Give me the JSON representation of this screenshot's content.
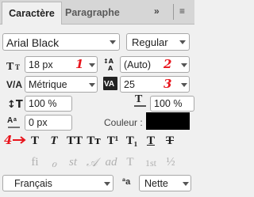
{
  "tabs": [
    {
      "label": "Caractère"
    },
    {
      "label": "Paragraphe"
    }
  ],
  "tabbar": {
    "more": "»",
    "menu": "≡"
  },
  "font": {
    "family": "Arial Black",
    "style": "Regular"
  },
  "size": {
    "value": "18 px",
    "annotation": "1"
  },
  "leading": {
    "value": "(Auto)",
    "annotation": "2"
  },
  "kerning": {
    "value": "Métrique"
  },
  "tracking": {
    "value": "25",
    "annotation": "3"
  },
  "vscale": {
    "value": "100 %"
  },
  "hscale": {
    "value": "100 %"
  },
  "baseline": {
    "value": "0 px"
  },
  "color": {
    "label": "Couleur :",
    "swatch": "#000000"
  },
  "styles": {
    "annotation": "4",
    "buttons": [
      {
        "name": "faux-bold-button",
        "glyph": "T"
      },
      {
        "name": "faux-italic-button",
        "glyph": "T"
      },
      {
        "name": "all-caps-button",
        "glyph": "TT"
      },
      {
        "name": "small-caps-button",
        "glyph": "Tт"
      },
      {
        "name": "superscript-button",
        "glyph": "T¹"
      },
      {
        "name": "subscript-button",
        "glyph": "T₁"
      },
      {
        "name": "underline-button",
        "glyph": "T"
      },
      {
        "name": "strikethrough-button",
        "glyph": "T"
      }
    ]
  },
  "opentype": {
    "buttons": [
      {
        "name": "ligatures-button",
        "glyph": "fi"
      },
      {
        "name": "discretionary-ligatures-button",
        "glyph": "ℴ"
      },
      {
        "name": "swash-button",
        "glyph": "st"
      },
      {
        "name": "stylistic-alternates-button",
        "glyph": "𝒜"
      },
      {
        "name": "titling-alternates-button",
        "glyph": "ad"
      },
      {
        "name": "ordinals-button",
        "glyph": "T"
      },
      {
        "name": "ordinal-st-button",
        "glyph": "1st"
      },
      {
        "name": "fractions-button",
        "glyph": "½"
      }
    ]
  },
  "language": {
    "value": "Français"
  },
  "antialias": {
    "icon": "ªa",
    "value": "Nette"
  }
}
